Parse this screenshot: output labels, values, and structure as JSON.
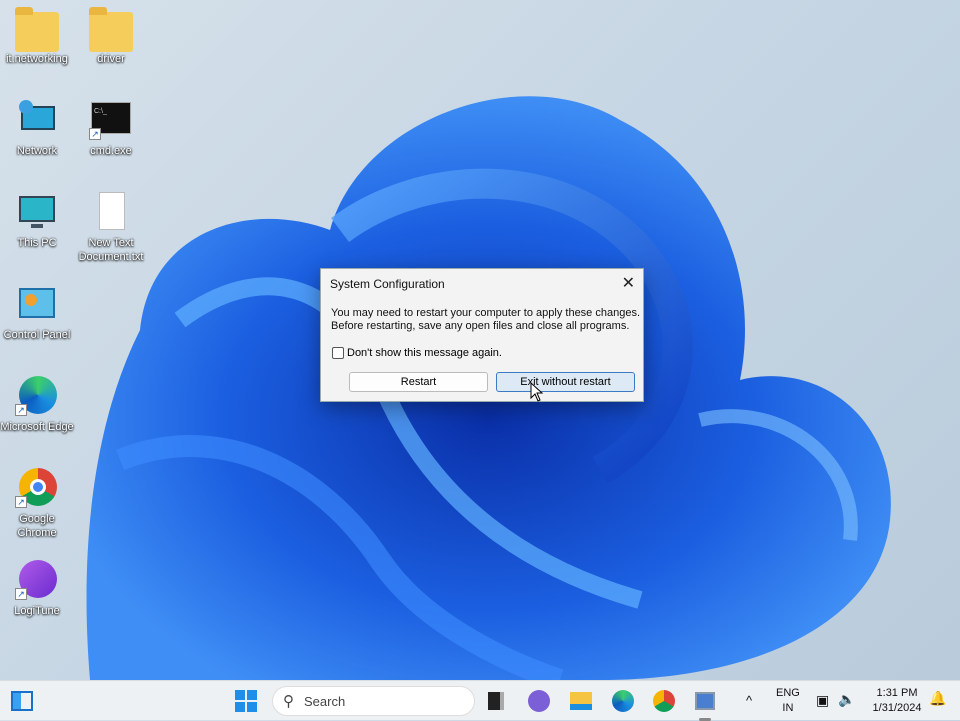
{
  "desktop": {
    "icons": [
      {
        "label": "it.networking",
        "icon": "folder-icon"
      },
      {
        "label": "driver",
        "icon": "folder-icon"
      },
      {
        "label": "Network",
        "icon": "network-icon"
      },
      {
        "label": "cmd.exe",
        "icon": "cmd-icon"
      },
      {
        "label": "This PC",
        "icon": "monitor-icon"
      },
      {
        "label": "New Text Document.txt",
        "icon": "text-file-icon"
      },
      {
        "label": "Control Panel",
        "icon": "control-panel-icon"
      },
      {
        "label": "Microsoft Edge",
        "icon": "edge-icon"
      },
      {
        "label": "Google Chrome",
        "icon": "chrome-icon"
      },
      {
        "label": "LogiTune",
        "icon": "logitune-icon"
      }
    ]
  },
  "dialog": {
    "title": "System Configuration",
    "close": "✕",
    "line1": "You may need to restart your computer to apply these changes.",
    "line2": "Before restarting, save any open files and close all programs.",
    "checkbox_label": "Don't show this message again.",
    "checkbox_checked": false,
    "restart_label": "Restart",
    "exit_label": "Exit without restart"
  },
  "taskbar": {
    "search_placeholder": "Search",
    "lang1": "ENG",
    "lang2": "IN",
    "time": "1:31 PM",
    "date": "1/31/2024",
    "chevron": "^"
  }
}
